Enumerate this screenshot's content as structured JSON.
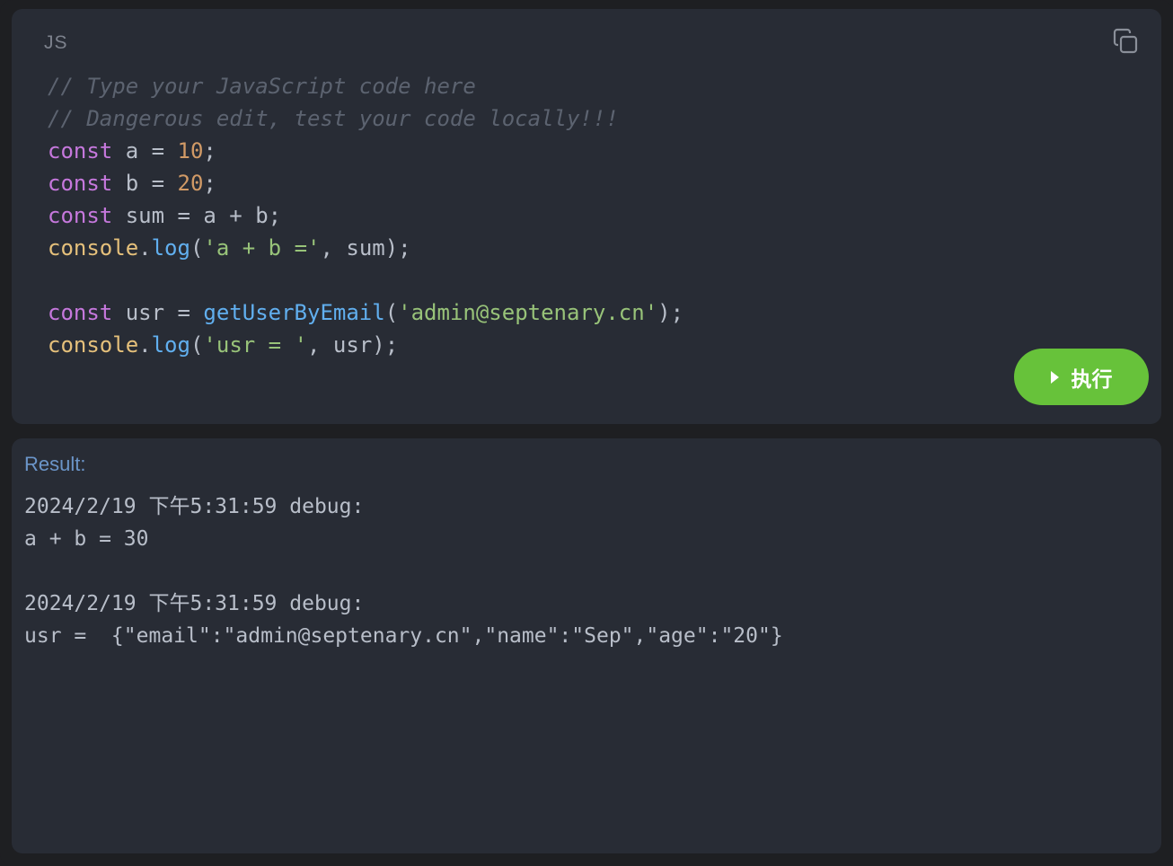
{
  "editor": {
    "language_label": "JS",
    "copy_icon": "copy-icon",
    "lines": [
      [
        {
          "t": "comment",
          "v": "// Type your JavaScript code here"
        }
      ],
      [
        {
          "t": "comment",
          "v": "// Dangerous edit, test your code locally!!!"
        }
      ],
      [
        {
          "t": "kw",
          "v": "const"
        },
        {
          "t": "plain",
          "v": " a = "
        },
        {
          "t": "num",
          "v": "10"
        },
        {
          "t": "plain",
          "v": ";"
        }
      ],
      [
        {
          "t": "kw",
          "v": "const"
        },
        {
          "t": "plain",
          "v": " b = "
        },
        {
          "t": "num",
          "v": "20"
        },
        {
          "t": "plain",
          "v": ";"
        }
      ],
      [
        {
          "t": "kw",
          "v": "const"
        },
        {
          "t": "plain",
          "v": " sum = a + b;"
        }
      ],
      [
        {
          "t": "obj",
          "v": "console"
        },
        {
          "t": "plain",
          "v": "."
        },
        {
          "t": "fn",
          "v": "log"
        },
        {
          "t": "plain",
          "v": "("
        },
        {
          "t": "str",
          "v": "'a + b ='"
        },
        {
          "t": "plain",
          "v": ", sum);"
        }
      ],
      [],
      [
        {
          "t": "kw",
          "v": "const"
        },
        {
          "t": "plain",
          "v": " usr = "
        },
        {
          "t": "fn",
          "v": "getUserByEmail"
        },
        {
          "t": "plain",
          "v": "("
        },
        {
          "t": "str",
          "v": "'admin@septenary.cn'"
        },
        {
          "t": "plain",
          "v": ");"
        }
      ],
      [
        {
          "t": "obj",
          "v": "console"
        },
        {
          "t": "plain",
          "v": "."
        },
        {
          "t": "fn",
          "v": "log"
        },
        {
          "t": "plain",
          "v": "("
        },
        {
          "t": "str",
          "v": "'usr = '"
        },
        {
          "t": "plain",
          "v": ", usr);"
        }
      ]
    ]
  },
  "run_button": {
    "label": "执行",
    "icon": "play-icon",
    "color": "#67c23a"
  },
  "result": {
    "title": "Result:",
    "lines": [
      "2024/2/19 下午5:31:59 debug:",
      "a + b = 30",
      "",
      "2024/2/19 下午5:31:59 debug:",
      "usr =  {\"email\":\"admin@septenary.cn\",\"name\":\"Sep\",\"age\":\"20\"}"
    ]
  },
  "colors": {
    "panel_bg": "#282c35",
    "comment": "#5c6370",
    "keyword": "#c678dd",
    "number": "#d19a66",
    "object": "#e5c07b",
    "function": "#61afef",
    "string": "#98c379",
    "result_title": "#6b95c9"
  }
}
